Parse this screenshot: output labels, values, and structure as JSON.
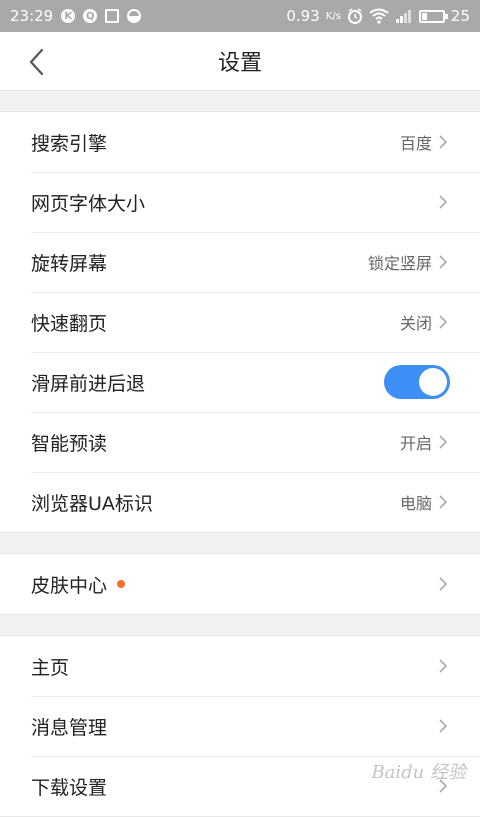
{
  "status_bar": {
    "time": "23:29",
    "icons_left": [
      "k-icon",
      "chat-icon",
      "image-icon",
      "half-circle-icon"
    ],
    "net_speed": "0.93",
    "net_unit": "K/s",
    "battery_level": "25",
    "battery_fraction": 0.25
  },
  "header": {
    "title": "设置",
    "back_icon": "chevron-left-icon"
  },
  "groups": [
    {
      "items": [
        {
          "label": "搜索引擎",
          "value": "百度"
        },
        {
          "label": "网页字体大小",
          "value": ""
        },
        {
          "label": "旋转屏幕",
          "value": "锁定竖屏"
        },
        {
          "label": "快速翻页",
          "value": "关闭"
        },
        {
          "label": "滑屏前进后退",
          "toggle": true
        },
        {
          "label": "智能预读",
          "value": "开启"
        },
        {
          "label": "浏览器UA标识",
          "value": "电脑"
        }
      ]
    },
    {
      "items": [
        {
          "label": "皮肤中心",
          "badge": true
        }
      ]
    },
    {
      "items": [
        {
          "label": "主页"
        },
        {
          "label": "消息管理"
        },
        {
          "label": "下载设置"
        }
      ]
    }
  ],
  "colors": {
    "accent": "#3d8ef5",
    "badge": "#f5702a",
    "statusbar": "#a9a9a9"
  },
  "watermark": "Baidu 经验"
}
